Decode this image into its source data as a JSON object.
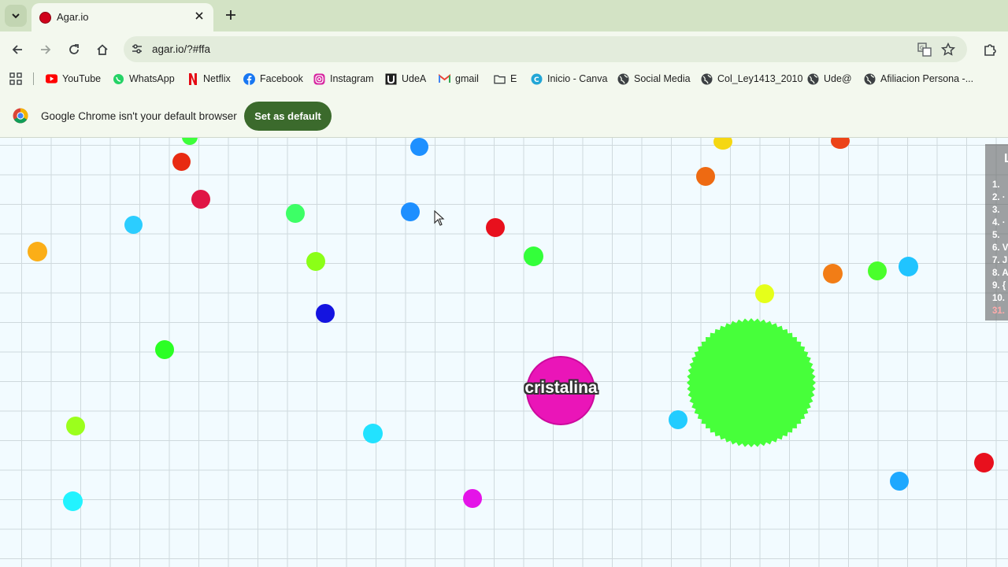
{
  "tab": {
    "title": "Agar.io"
  },
  "toolbar": {
    "url": "agar.io/?#ffa"
  },
  "bookmarks": [
    {
      "label": "YouTube",
      "icon": "youtube-icon"
    },
    {
      "label": "WhatsApp",
      "icon": "whatsapp-icon"
    },
    {
      "label": "Netflix",
      "icon": "netflix-icon"
    },
    {
      "label": "Facebook",
      "icon": "facebook-icon"
    },
    {
      "label": "Instagram",
      "icon": "instagram-icon"
    },
    {
      "label": "UdeA",
      "icon": "udea-icon"
    },
    {
      "label": "gmail",
      "icon": "gmail-icon"
    },
    {
      "label": "E",
      "icon": "folder-icon"
    },
    {
      "label": "Inicio - Canva",
      "icon": "canva-icon"
    },
    {
      "label": "Social Media",
      "icon": "globe-icon"
    },
    {
      "label": "Col_Ley1413_2010",
      "icon": "globe-icon"
    },
    {
      "label": "Ude@",
      "icon": "globe-icon"
    },
    {
      "label": "Afiliacion Persona -...",
      "icon": "globe-icon"
    }
  ],
  "infobar": {
    "message": "Google Chrome isn't your default browser",
    "button": "Set as default"
  },
  "game": {
    "player_name": "cristalina",
    "player_color": "#ea15b8",
    "enemy_color": "#47ff3a",
    "leaderboard": {
      "title": "L",
      "rows": [
        "1.",
        "2. ·",
        "3.",
        "4. ·",
        "5.",
        "6. V",
        "7. J",
        "8. A",
        "9. {",
        "10.",
        "31."
      ],
      "own_rank_color": "#ffaaaa"
    }
  }
}
